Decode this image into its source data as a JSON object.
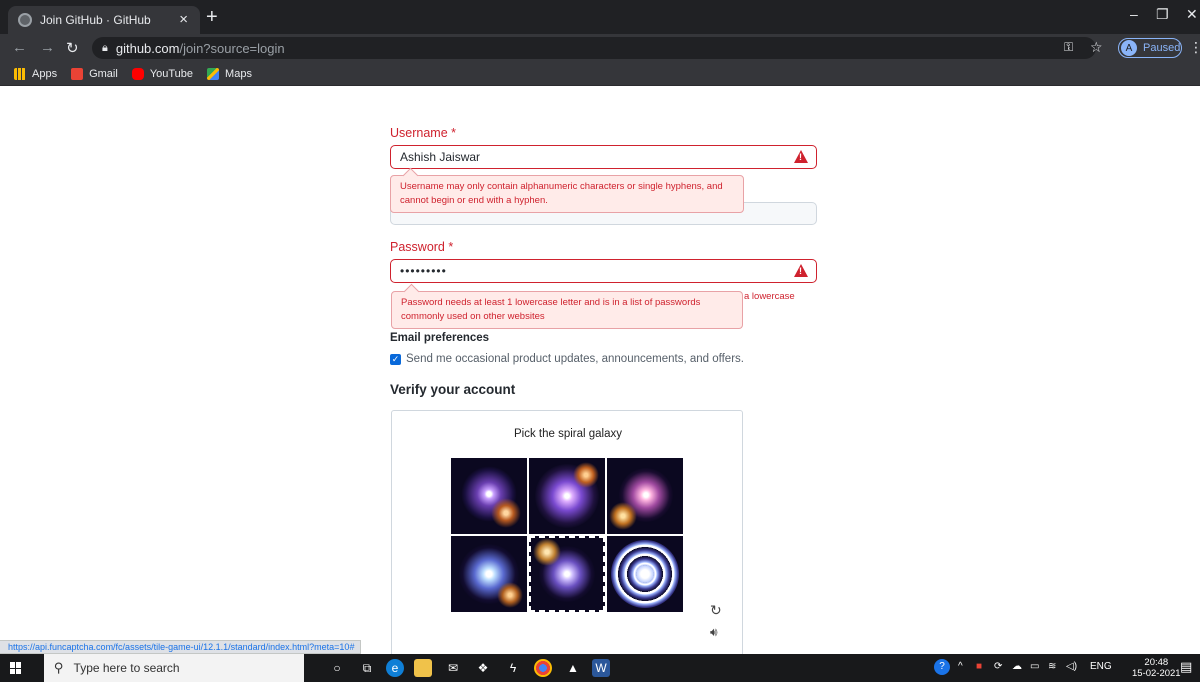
{
  "browser": {
    "tab_title": "Join GitHub · GitHub",
    "url_host": "github.com",
    "url_path": "/join?source=login",
    "profile_initial": "A",
    "profile_status": "Paused",
    "bookmarks": [
      {
        "label": "Apps",
        "color": "#ea4335"
      },
      {
        "label": "Gmail",
        "color": "#ea4335"
      },
      {
        "label": "YouTube",
        "color": "#ff0000"
      },
      {
        "label": "Maps",
        "color": "#34a853"
      }
    ],
    "status_url": "https://api.funcaptcha.com/fc/assets/tile-game-ui/12.1.1/standard/index.html?meta=10#"
  },
  "form": {
    "username_label": "Username *",
    "username_value": "Ashish Jaiswar",
    "username_error": "Username may only contain alphanumeric characters or single hyphens, and cannot begin or end with a hyphen.",
    "password_label": "Password *",
    "password_value": "•••••••••",
    "password_error": "Password needs at least 1 lowercase letter and is in a list of passwords commonly used on other websites",
    "password_error_tail": "a lowercase",
    "email_pref_label": "Email preferences",
    "email_pref_checkbox": "Send me occasional product updates, announcements, and offers.",
    "verify_label": "Verify your account"
  },
  "captcha": {
    "prompt": "Pick the spiral galaxy"
  },
  "taskbar": {
    "search_placeholder": "Type here to search",
    "language": "ENG",
    "time": "20:48",
    "date": "15-02-2021"
  },
  "colors": {
    "error": "#cf222e",
    "accent": "#0969da"
  }
}
